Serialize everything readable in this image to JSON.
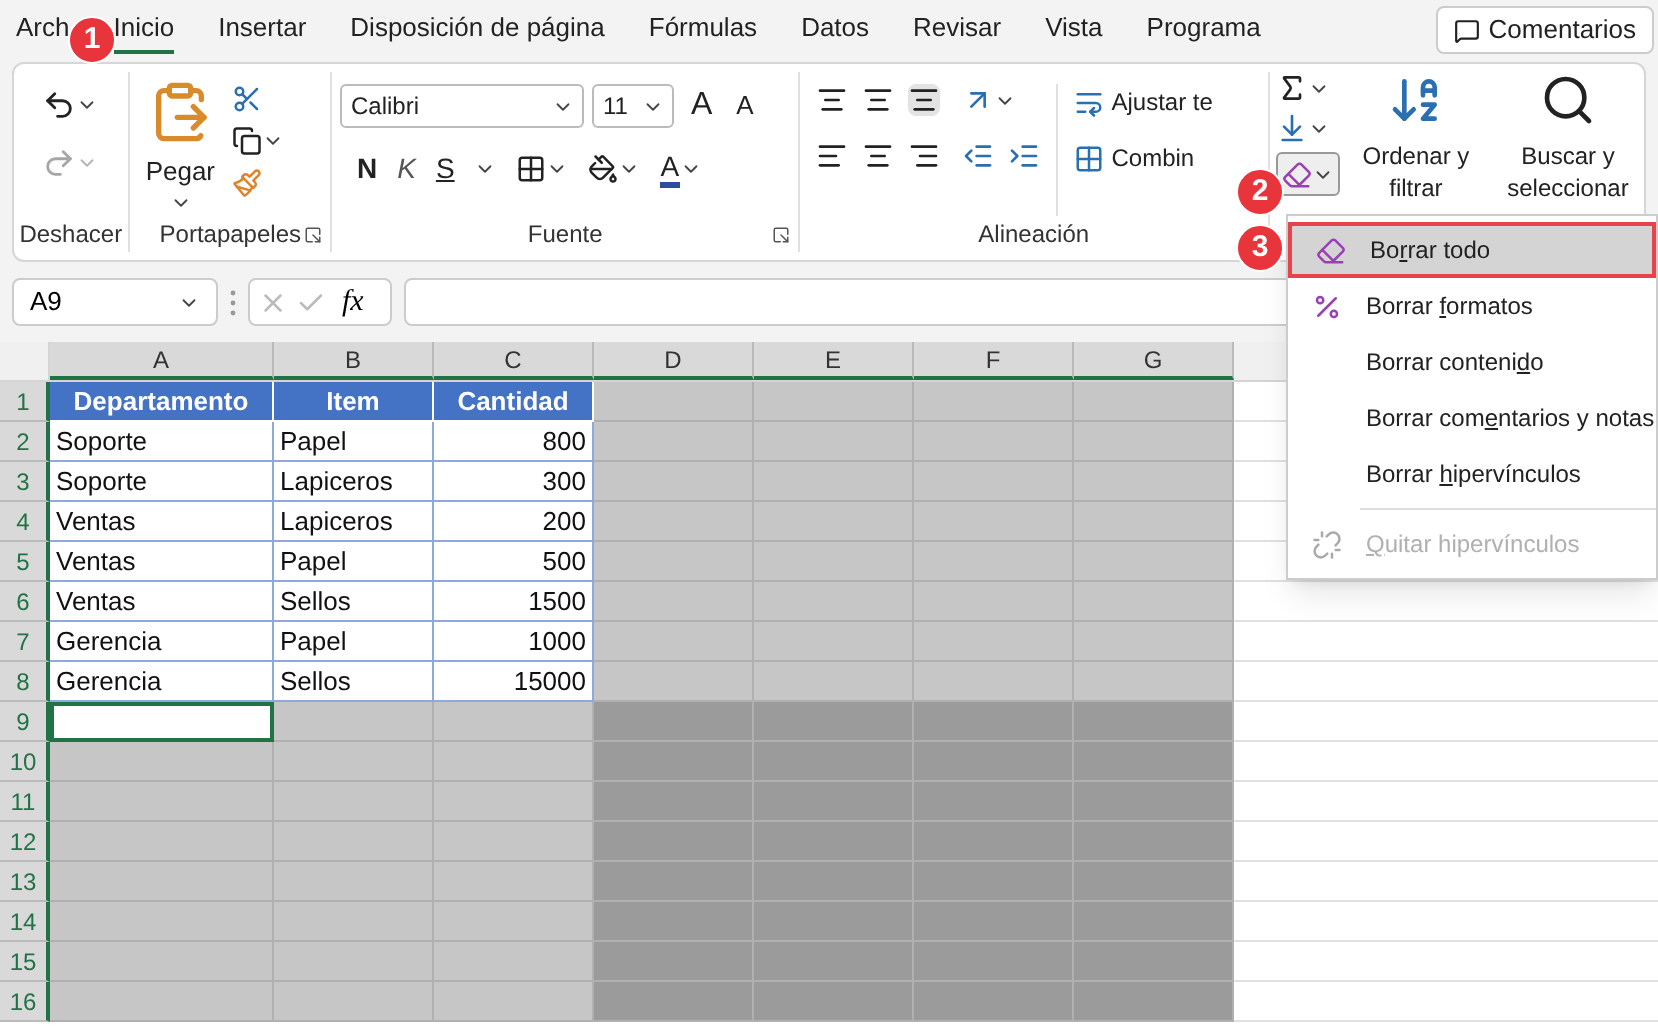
{
  "tabs": [
    {
      "label": "Arch",
      "selected": false
    },
    {
      "label": "Inicio",
      "selected": true
    },
    {
      "label": "Insertar",
      "selected": false
    },
    {
      "label": "Disposición de página",
      "selected": false
    },
    {
      "label": "Fórmulas",
      "selected": false
    },
    {
      "label": "Datos",
      "selected": false
    },
    {
      "label": "Revisar",
      "selected": false
    },
    {
      "label": "Vista",
      "selected": false
    },
    {
      "label": "Programa",
      "selected": false
    }
  ],
  "comments_button": "Comentarios",
  "callouts": [
    "1",
    "2",
    "3"
  ],
  "ribbon": {
    "undo": {
      "label": "Deshacer"
    },
    "clipboard": {
      "paste": "Pegar",
      "label": "Portapapeles"
    },
    "font": {
      "name": "Calibri",
      "size": "11",
      "grow": "A",
      "shrink": "A",
      "bold": "N",
      "italic": "K",
      "underline": "S",
      "color_letter": "A",
      "label": "Fuente"
    },
    "alignment": {
      "wrap": "Ajustar te",
      "merge": "Combin",
      "label": "Alineación"
    },
    "editing": {
      "sort": "Ordenar y filtrar",
      "find": "Buscar y seleccionar"
    }
  },
  "clear_menu": [
    {
      "kind": "eraser",
      "selected": true,
      "disabled": false,
      "parts": [
        {
          "text": "Bo",
          "underline": false
        },
        {
          "text": "r",
          "underline": true
        },
        {
          "text": "rar todo",
          "underline": false
        }
      ]
    },
    {
      "kind": "formats",
      "selected": false,
      "disabled": false,
      "parts": [
        {
          "text": "Borrar ",
          "underline": false
        },
        {
          "text": "f",
          "underline": true
        },
        {
          "text": "ormatos",
          "underline": false
        }
      ]
    },
    {
      "kind": "plain",
      "selected": false,
      "disabled": false,
      "parts": [
        {
          "text": "Borrar conteni",
          "underline": false
        },
        {
          "text": "d",
          "underline": true
        },
        {
          "text": "o",
          "underline": false
        }
      ]
    },
    {
      "kind": "plain",
      "selected": false,
      "disabled": false,
      "parts": [
        {
          "text": "Borrar com",
          "underline": false
        },
        {
          "text": "e",
          "underline": true
        },
        {
          "text": "ntarios y notas",
          "underline": false
        }
      ]
    },
    {
      "kind": "plain",
      "selected": false,
      "disabled": false,
      "parts": [
        {
          "text": "Borrar ",
          "underline": false
        },
        {
          "text": "h",
          "underline": true
        },
        {
          "text": "ipervínculos",
          "underline": false
        }
      ]
    },
    {
      "kind": "unlink",
      "selected": false,
      "disabled": true,
      "parts": [
        {
          "text": "Q",
          "underline": true
        },
        {
          "text": "uitar hipervínculos",
          "underline": false
        }
      ]
    }
  ],
  "formula_bar": {
    "name_box": "A9",
    "function_label": "fx"
  },
  "sheet": {
    "columns": [
      "A",
      "B",
      "C",
      "D",
      "E",
      "F",
      "G"
    ],
    "rows": [
      {
        "number": "1",
        "cells": [
          {
            "text": "Departamento",
            "kind": "header",
            "selected": false,
            "overlap": false
          },
          {
            "text": "Item",
            "kind": "header",
            "selected": false,
            "overlap": false
          },
          {
            "text": "Cantidad",
            "kind": "header",
            "selected": false,
            "overlap": false
          },
          {
            "selected": true,
            "overlap": false
          },
          {
            "selected": true,
            "overlap": false
          },
          {
            "selected": true,
            "overlap": false
          },
          {
            "selected": true,
            "overlap": false
          }
        ]
      },
      {
        "number": "2",
        "cells": [
          {
            "text": "Soporte",
            "kind": "text",
            "selected": false,
            "overlap": false
          },
          {
            "text": "Papel",
            "kind": "text",
            "selected": false,
            "overlap": false
          },
          {
            "text": "800",
            "kind": "number",
            "selected": false,
            "overlap": false
          },
          {
            "selected": true,
            "overlap": false
          },
          {
            "selected": true,
            "overlap": false
          },
          {
            "selected": true,
            "overlap": false
          },
          {
            "selected": true,
            "overlap": false
          }
        ]
      },
      {
        "number": "3",
        "cells": [
          {
            "text": "Soporte",
            "kind": "text",
            "selected": false,
            "overlap": false
          },
          {
            "text": "Lapiceros",
            "kind": "text",
            "selected": false,
            "overlap": false
          },
          {
            "text": "300",
            "kind": "number",
            "selected": false,
            "overlap": false
          },
          {
            "selected": true,
            "overlap": false
          },
          {
            "selected": true,
            "overlap": false
          },
          {
            "selected": true,
            "overlap": false
          },
          {
            "selected": true,
            "overlap": false
          }
        ]
      },
      {
        "number": "4",
        "cells": [
          {
            "text": "Ventas",
            "kind": "text",
            "selected": false,
            "overlap": false
          },
          {
            "text": "Lapiceros",
            "kind": "text",
            "selected": false,
            "overlap": false
          },
          {
            "text": "200",
            "kind": "number",
            "selected": false,
            "overlap": false
          },
          {
            "selected": true,
            "overlap": false
          },
          {
            "selected": true,
            "overlap": false
          },
          {
            "selected": true,
            "overlap": false
          },
          {
            "selected": true,
            "overlap": false
          }
        ]
      },
      {
        "number": "5",
        "cells": [
          {
            "text": "Ventas",
            "kind": "text",
            "selected": false,
            "overlap": false
          },
          {
            "text": "Papel",
            "kind": "text",
            "selected": false,
            "overlap": false
          },
          {
            "text": "500",
            "kind": "number",
            "selected": false,
            "overlap": false
          },
          {
            "selected": true,
            "overlap": false
          },
          {
            "selected": true,
            "overlap": false
          },
          {
            "selected": true,
            "overlap": false
          },
          {
            "selected": true,
            "overlap": false
          }
        ]
      },
      {
        "number": "6",
        "cells": [
          {
            "text": "Ventas",
            "kind": "text",
            "selected": false,
            "overlap": false
          },
          {
            "text": "Sellos",
            "kind": "text",
            "selected": false,
            "overlap": false
          },
          {
            "text": "1500",
            "kind": "number",
            "selected": false,
            "overlap": false
          },
          {
            "selected": true,
            "overlap": false
          },
          {
            "selected": true,
            "overlap": false
          },
          {
            "selected": true,
            "overlap": false
          },
          {
            "selected": true,
            "overlap": false
          }
        ]
      },
      {
        "number": "7",
        "cells": [
          {
            "text": "Gerencia",
            "kind": "text",
            "selected": false,
            "overlap": false
          },
          {
            "text": "Papel",
            "kind": "text",
            "selected": false,
            "overlap": false
          },
          {
            "text": "1000",
            "kind": "number",
            "selected": false,
            "overlap": false
          },
          {
            "selected": true,
            "overlap": false
          },
          {
            "selected": true,
            "overlap": false
          },
          {
            "selected": true,
            "overlap": false
          },
          {
            "selected": true,
            "overlap": false
          }
        ]
      },
      {
        "number": "8",
        "cells": [
          {
            "text": "Gerencia",
            "kind": "text",
            "selected": false,
            "overlap": false
          },
          {
            "text": "Sellos",
            "kind": "text",
            "selected": false,
            "overlap": false
          },
          {
            "text": "15000",
            "kind": "number",
            "selected": false,
            "overlap": false
          },
          {
            "selected": true,
            "overlap": false
          },
          {
            "selected": true,
            "overlap": false
          },
          {
            "selected": true,
            "overlap": false
          },
          {
            "selected": true,
            "overlap": false
          }
        ]
      },
      {
        "number": "9",
        "cells": [
          {
            "selected": false,
            "overlap": false,
            "active": true
          },
          {
            "selected": true,
            "overlap": false
          },
          {
            "selected": true,
            "overlap": false
          },
          {
            "selected": true,
            "overlap": true
          },
          {
            "selected": true,
            "overlap": true
          },
          {
            "selected": true,
            "overlap": true
          },
          {
            "selected": true,
            "overlap": true
          }
        ]
      },
      {
        "number": "10",
        "cells": [
          {
            "selected": true,
            "overlap": false
          },
          {
            "selected": true,
            "overlap": false
          },
          {
            "selected": true,
            "overlap": false
          },
          {
            "selected": true,
            "overlap": true
          },
          {
            "selected": true,
            "overlap": true
          },
          {
            "selected": true,
            "overlap": true
          },
          {
            "selected": true,
            "overlap": true
          }
        ]
      },
      {
        "number": "11",
        "cells": [
          {
            "selected": true,
            "overlap": false
          },
          {
            "selected": true,
            "overlap": false
          },
          {
            "selected": true,
            "overlap": false
          },
          {
            "selected": true,
            "overlap": true
          },
          {
            "selected": true,
            "overlap": true
          },
          {
            "selected": true,
            "overlap": true
          },
          {
            "selected": true,
            "overlap": true
          }
        ]
      },
      {
        "number": "12",
        "cells": [
          {
            "selected": true,
            "overlap": false
          },
          {
            "selected": true,
            "overlap": false
          },
          {
            "selected": true,
            "overlap": false
          },
          {
            "selected": true,
            "overlap": true
          },
          {
            "selected": true,
            "overlap": true
          },
          {
            "selected": true,
            "overlap": true
          },
          {
            "selected": true,
            "overlap": true
          }
        ]
      },
      {
        "number": "13",
        "cells": [
          {
            "selected": true,
            "overlap": false
          },
          {
            "selected": true,
            "overlap": false
          },
          {
            "selected": true,
            "overlap": false
          },
          {
            "selected": true,
            "overlap": true
          },
          {
            "selected": true,
            "overlap": true
          },
          {
            "selected": true,
            "overlap": true
          },
          {
            "selected": true,
            "overlap": true
          }
        ]
      },
      {
        "number": "14",
        "cells": [
          {
            "selected": true,
            "overlap": false
          },
          {
            "selected": true,
            "overlap": false
          },
          {
            "selected": true,
            "overlap": false
          },
          {
            "selected": true,
            "overlap": true
          },
          {
            "selected": true,
            "overlap": true
          },
          {
            "selected": true,
            "overlap": true
          },
          {
            "selected": true,
            "overlap": true
          }
        ]
      },
      {
        "number": "15",
        "cells": [
          {
            "selected": true,
            "overlap": false
          },
          {
            "selected": true,
            "overlap": false
          },
          {
            "selected": true,
            "overlap": false
          },
          {
            "selected": true,
            "overlap": true
          },
          {
            "selected": true,
            "overlap": true
          },
          {
            "selected": true,
            "overlap": true
          },
          {
            "selected": true,
            "overlap": true
          }
        ]
      },
      {
        "number": "16",
        "cells": [
          {
            "selected": true,
            "overlap": false
          },
          {
            "selected": true,
            "overlap": false
          },
          {
            "selected": true,
            "overlap": false
          },
          {
            "selected": true,
            "overlap": true
          },
          {
            "selected": true,
            "overlap": true
          },
          {
            "selected": true,
            "overlap": true
          },
          {
            "selected": true,
            "overlap": true
          }
        ]
      }
    ]
  }
}
